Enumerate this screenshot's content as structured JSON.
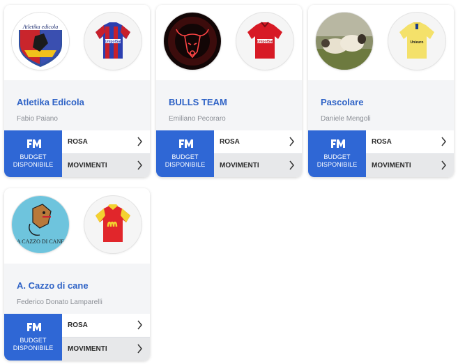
{
  "budget_label_line1": "BUDGET",
  "budget_label_line2": "DISPONIBILE",
  "budget_icon": "fm-logo-icon",
  "actions": {
    "rosa": "ROSA",
    "movimenti": "MOVIMENTI"
  },
  "accent_color": "#2f67d5",
  "team_name_color": "#2f63c6",
  "teams": [
    {
      "name": "Atletika Edicola",
      "manager": "Fabio Paiano",
      "logo_text": "Atletika edicola",
      "logo_icon": "shield-crest-icon",
      "shirt_icon": "blue-red-shirt-icon",
      "shirt_sponsor": "UnipolSai"
    },
    {
      "name": "BULLS TEAM",
      "manager": "Emiliano Pecoraro",
      "logo_icon": "neon-bull-icon",
      "shirt_icon": "red-shirt-icon",
      "shirt_sponsor": "UnipolSai"
    },
    {
      "name": "Pascolare",
      "manager": "Daniele Mengoli",
      "logo_icon": "sheep-photo-icon",
      "shirt_icon": "yellow-shirt-icon",
      "shirt_sponsor": "Unieuro"
    },
    {
      "name": "A. Cazzo di cane",
      "manager": "Federico Donato Lamparelli",
      "logo_text": "A CAZZO DI CANE",
      "logo_icon": "dog-cartoon-icon",
      "shirt_icon": "red-yellow-shirt-icon"
    }
  ]
}
